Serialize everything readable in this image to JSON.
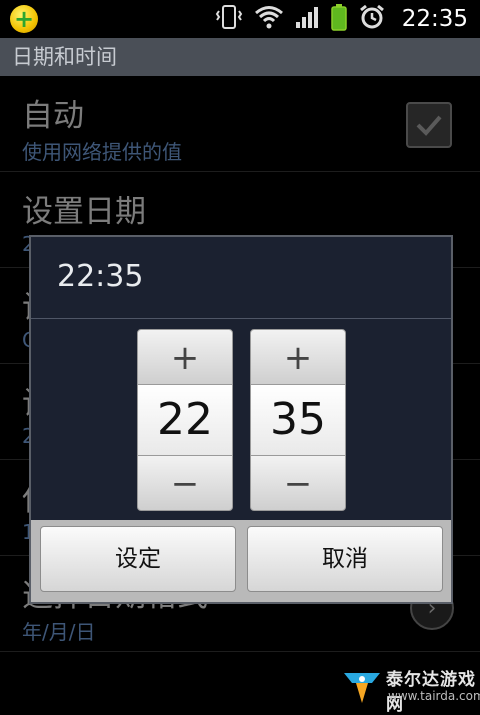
{
  "status_bar": {
    "time": "22:35",
    "icons": [
      "vibrate-icon",
      "wifi-icon",
      "signal-icon",
      "battery-icon",
      "alarm-icon"
    ]
  },
  "title_bar": {
    "title": "日期和时间"
  },
  "list": {
    "items": [
      {
        "title": "自动",
        "subtitle": "使用网络提供的值",
        "control": "checkbox",
        "checked": true
      },
      {
        "title": "设置日期",
        "subtitle": "2"
      },
      {
        "title": "设",
        "subtitle": "C"
      },
      {
        "title": "设",
        "subtitle": "2"
      },
      {
        "title": "使",
        "subtitle": "1"
      },
      {
        "title": "选择日期格式",
        "subtitle": "年/月/日",
        "control": "arrow"
      }
    ]
  },
  "dialog": {
    "title": "22:35",
    "hour": "22",
    "minute": "35",
    "plus_label": "+",
    "minus_label": "−",
    "ok_label": "设定",
    "cancel_label": "取消"
  },
  "watermark": {
    "text": "泰尔达游戏网",
    "url": "www.tairda.com"
  },
  "colors": {
    "title_bar_bg": "#4a4f57",
    "dialog_bg": "#1b2130",
    "subtitle_blue": "#3e5677"
  }
}
